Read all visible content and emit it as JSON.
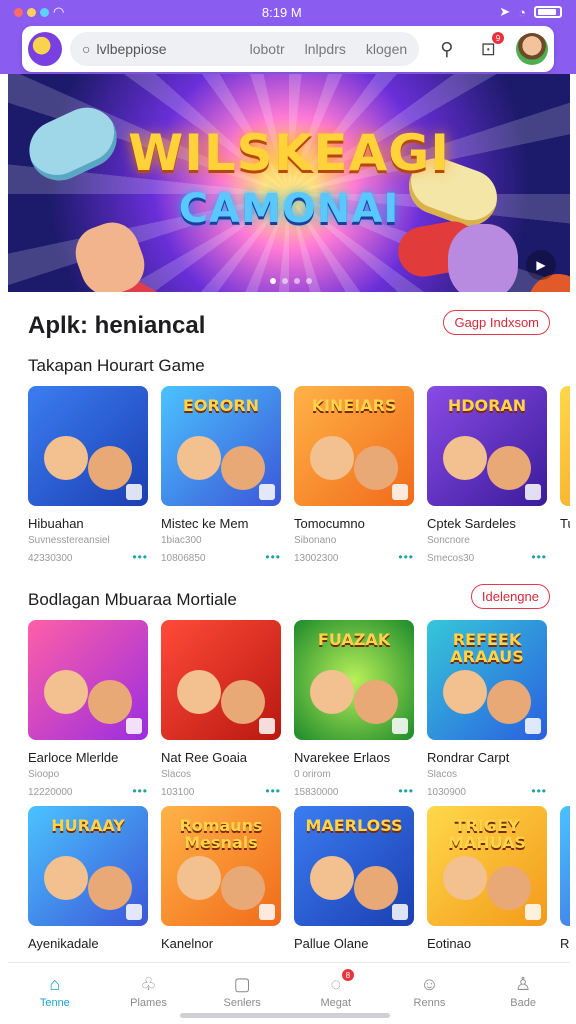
{
  "status": {
    "time": "8:19 M"
  },
  "search": {
    "placeholder": "lvlbeppiose",
    "chips": [
      "lobotr",
      "lnlpdrs",
      "klogen"
    ]
  },
  "notifications": {
    "count": "9"
  },
  "hero": {
    "title_line1": "WILSKEAGI",
    "title_line2": "CAMONAI"
  },
  "section1": {
    "title": "Aplk: heniancal",
    "button": "Gagp Indxsom",
    "subtitle": "Takapan Hourart Game",
    "cards": [
      {
        "name": "Hibuahan",
        "meta1": "Suvnesstereansiel",
        "meta2": "42330300",
        "thumb_text": "",
        "bg": "g-blue"
      },
      {
        "name": "Mistec ke Mem",
        "meta1": "1biac300",
        "meta2": "10806850",
        "thumb_text": "EORORN",
        "bg": "g-sky"
      },
      {
        "name": "Tomocumno",
        "meta1": "Sibonano",
        "meta2": "13002300",
        "thumb_text": "KINEIARS",
        "bg": "g-orange"
      },
      {
        "name": "Cptek Sardeles",
        "meta1": "Soncnore",
        "meta2": "Smecos30",
        "thumb_text": "HDORAN",
        "bg": "g-purple"
      },
      {
        "name": "Tu",
        "meta1": "",
        "meta2": "",
        "thumb_text": "",
        "bg": "g-yellow"
      }
    ]
  },
  "section2": {
    "title": "Bodlagan Mbuaraa Mortiale",
    "button": "Idelengne",
    "cards": [
      {
        "name": "Earloce Mlerlde",
        "meta1": "Sioopo",
        "meta2": "12220000",
        "thumb_text": "",
        "bg": "g-pink"
      },
      {
        "name": "Nat Ree Goaia",
        "meta1": "Slacos",
        "meta2": "103100",
        "thumb_text": "",
        "bg": "g-red"
      },
      {
        "name": "Nvarekee Erlaos",
        "meta1": "0 orirom",
        "meta2": "15830000",
        "thumb_text": "FUAZAK",
        "bg": "g-green"
      },
      {
        "name": "Rondrar Carpt",
        "meta1": "Slacos",
        "meta2": "1030900",
        "thumb_text": "REFEEK ARAAUS",
        "bg": "g-teal"
      }
    ]
  },
  "section3": {
    "cards": [
      {
        "name": "Ayenikadale",
        "meta1": "",
        "meta2": "",
        "thumb_text": "HURAAY",
        "bg": "g-sky"
      },
      {
        "name": "Kanelnor",
        "meta1": "",
        "meta2": "",
        "thumb_text": "Romauns Mesnals",
        "bg": "g-orange"
      },
      {
        "name": "Pallue Olane",
        "meta1": "",
        "meta2": "",
        "thumb_text": "MAERLOSS",
        "bg": "g-blue"
      },
      {
        "name": "Eotinao",
        "meta1": "",
        "meta2": "",
        "thumb_text": "TRIGEY MAHUAS",
        "bg": "g-yellow"
      },
      {
        "name": "R",
        "meta1": "",
        "meta2": "",
        "thumb_text": "",
        "bg": "g-sky"
      }
    ]
  },
  "nav": [
    {
      "label": "Tenne",
      "icon": "home-icon",
      "glyph": "⌂",
      "active": true
    },
    {
      "label": "Plames",
      "icon": "games-icon",
      "glyph": "♧",
      "active": false
    },
    {
      "label": "Senlers",
      "icon": "store-icon",
      "glyph": "▢",
      "active": false
    },
    {
      "label": "Megat",
      "icon": "messages-icon",
      "glyph": "◌",
      "active": false,
      "badge": "8"
    },
    {
      "label": "Renns",
      "icon": "chat-icon",
      "glyph": "☺",
      "active": false
    },
    {
      "label": "Bade",
      "icon": "profile-icon",
      "glyph": "♙",
      "active": false
    }
  ]
}
